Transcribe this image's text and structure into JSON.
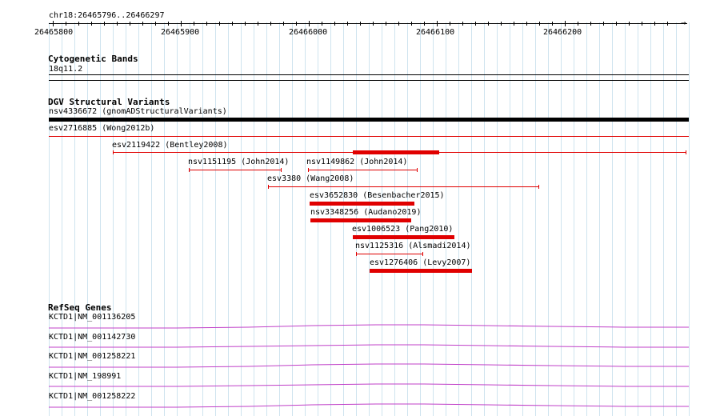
{
  "locus": "chr18:26465796..26466297",
  "ruler": {
    "labels": [
      "26465800",
      "26465900",
      "26466000",
      "26466100",
      "26466200"
    ],
    "arrow": "→"
  },
  "tracks": {
    "cytoband": {
      "title": "Cytogenetic Bands",
      "band": "18q11.2"
    },
    "dgv": {
      "title": "DGV Structural Variants",
      "features": [
        {
          "label": "nsv4336672 (gnomADStructuralVariants)",
          "start": 26465796,
          "end": 26466297
        },
        {
          "label": "esv2716885 (Wong2012b)",
          "start": 26465796,
          "end": 26466297
        },
        {
          "label": "esv2119422 (Bentley2008)",
          "start": 26465850,
          "end": 26466300
        },
        {
          "label": "nsv1151195 (John2014)",
          "start": 26465907,
          "end": 26465980
        },
        {
          "label": "nsv1149862 (John2014)",
          "start": 26466000,
          "end": 26466085
        },
        {
          "label": "esv3380 (Wang2008)",
          "start": 26465969,
          "end": 26466181
        },
        {
          "label": "esv3652830 (Besenbacher2015)",
          "start": 26466001,
          "end": 26466082
        },
        {
          "label": "nsv3348256 (Audano2019)",
          "start": 26466002,
          "end": 26466080
        },
        {
          "label": "esv1006523 (Pang2010)",
          "start": 26466035,
          "end": 26466114
        },
        {
          "label": "nsv1125316 (Alsmadi2014)",
          "start": 26466037,
          "end": 26466089
        },
        {
          "label": "esv1276406 (Levy2007)",
          "start": 26466048,
          "end": 26466128
        }
      ]
    },
    "refseq": {
      "title": "RefSeq Genes",
      "genes": [
        {
          "label": "KCTD1|NM_001136205"
        },
        {
          "label": "KCTD1|NM_001142730"
        },
        {
          "label": "KCTD1|NM_001258221"
        },
        {
          "label": "KCTD1|NM_198991"
        },
        {
          "label": "KCTD1|NM_001258222"
        }
      ]
    }
  },
  "colors": {
    "grid": "#cfe3ef",
    "variant": "#e00000",
    "gene": "#c040c8"
  }
}
